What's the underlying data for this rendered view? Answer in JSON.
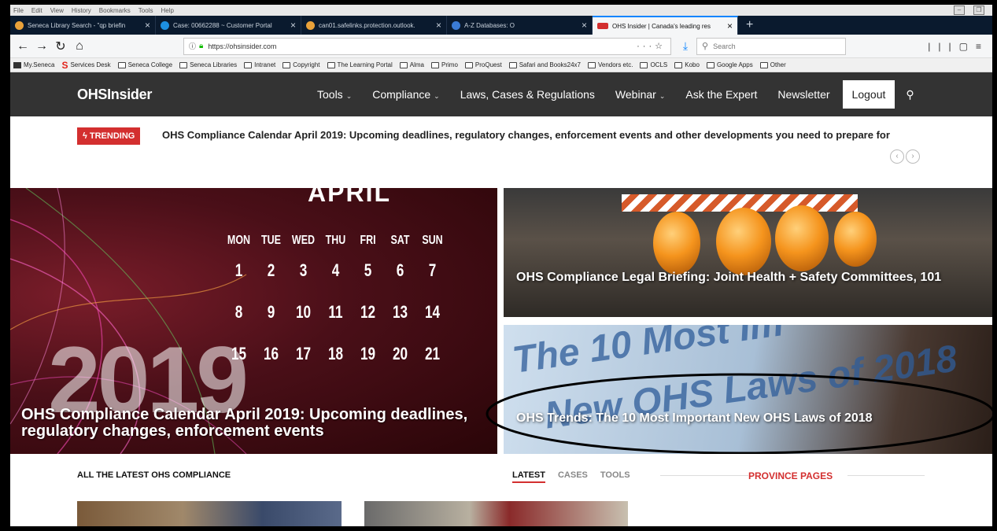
{
  "browser": {
    "menu": [
      "File",
      "Edit",
      "View",
      "History",
      "Bookmarks",
      "Tools",
      "Help"
    ],
    "tabs": [
      {
        "label": "Seneca Library Search - \"qp briefin",
        "color": "#e8a13a"
      },
      {
        "label": "Case: 00662288 ~ Customer Portal",
        "color": "#1d8fe0"
      },
      {
        "label": "can01.safelinks.protection.outlook.",
        "color": "#e8a13a"
      },
      {
        "label": "A-Z Databases: O",
        "color": "#3a7bd5"
      },
      {
        "label": "OHS Insider | Canada's leading res",
        "color": "#d32f2f"
      }
    ],
    "url": "https://ohsinsider.com",
    "search_placeholder": "Search",
    "bookmarks": [
      "My.Seneca",
      "Services Desk",
      "Seneca College",
      "Seneca Libraries",
      "Intranet",
      "Copyright",
      "The Learning Portal",
      "Alma",
      "Primo",
      "ProQuest",
      "Safari and Books24x7",
      "Vendors etc.",
      "OCLS",
      "Kobo",
      "Google Apps",
      "Other"
    ]
  },
  "site": {
    "logo": "OHSInsider",
    "nav": [
      {
        "label": "Tools",
        "dropdown": true
      },
      {
        "label": "Compliance",
        "dropdown": true
      },
      {
        "label": "Laws, Cases & Regulations",
        "dropdown": false
      },
      {
        "label": "Webinar",
        "dropdown": true
      },
      {
        "label": "Ask the Expert",
        "dropdown": false
      },
      {
        "label": "Newsletter",
        "dropdown": false
      }
    ],
    "logout": "Logout",
    "trending_badge": "ϟ TRENDING",
    "trending_text": "OHS Compliance Calendar April 2019: Upcoming deadlines, regulatory changes, enforcement events and other developments you need to prepare for"
  },
  "hero": {
    "calendar": {
      "month": "APRIL",
      "days": [
        "MON",
        "TUE",
        "WED",
        "THU",
        "FRI",
        "SAT",
        "SUN"
      ],
      "weeks": [
        [
          "1",
          "2",
          "3",
          "4",
          "5",
          "6",
          "7"
        ],
        [
          "8",
          "9",
          "10",
          "11",
          "12",
          "13",
          "14"
        ],
        [
          "15",
          "16",
          "17",
          "18",
          "19",
          "20",
          "21"
        ]
      ],
      "year": "2019"
    },
    "big_title": "OHS Compliance Calendar April 2019: Upcoming deadlines, regulatory changes, enforcement events",
    "top_title": "OHS Compliance Legal Briefing: Joint Health + Safety Committees, 101",
    "bottom_title": "OHS Trends: The 10 Most Important New OHS Laws of 2018",
    "bottom_image_text_1": "The 10 Most Im",
    "bottom_image_text_2": "New OHS Laws of 2018"
  },
  "latest": {
    "heading": "ALL THE LATEST OHS COMPLIANCE",
    "tabs": [
      "LATEST",
      "CASES",
      "TOOLS"
    ],
    "province": "PROVINCE PAGES"
  }
}
